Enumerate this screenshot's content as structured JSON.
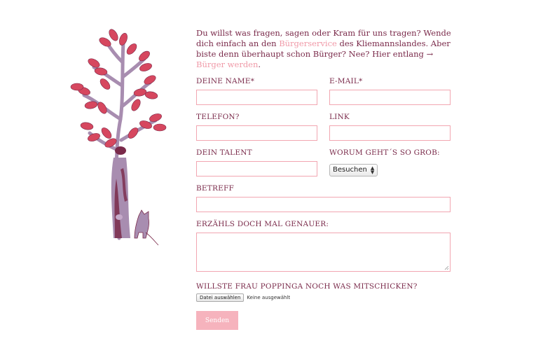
{
  "intro": {
    "part1": "Du willst was fragen, sagen oder Kram für uns tragen? Wende dich einfach an den ",
    "link1": "Bürgerservice",
    "part2": " des Kliemannslandes. Aber biste denn überhaupt schon Bürger? Nee? Hier entlang → ",
    "link2": "Bürger werden",
    "part3": "."
  },
  "form": {
    "name_label": "DEINE NAME*",
    "email_label": "E-MAIL*",
    "phone_label": "TELEFON?",
    "link_label": "LINK",
    "talent_label": "DEIN TALENT",
    "topic_label": "WORUM GEHT´S SO GROB:",
    "topic_selected": "Besuchen",
    "subject_label": "BETREFF",
    "message_label": "ERZÄHLS DOCH MAL GENAUER:",
    "file_label": "WILLSTE FRAU POPPINGA NOCH WAS MITSCHICKEN?",
    "file_button": "Datei auswählen",
    "file_status": "Keine ausgewählt",
    "submit_label": "Senden"
  },
  "colors": {
    "accent": "#f2a6b1",
    "text": "#7a2a4a",
    "leaf": "#d6475f",
    "trunk": "#a88db0"
  },
  "illustration": {
    "icons": [
      "tree-icon",
      "cat-icon"
    ]
  }
}
